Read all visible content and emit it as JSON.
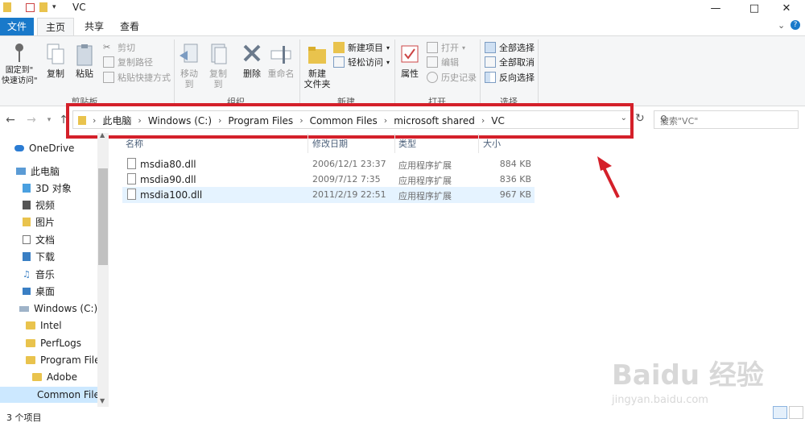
{
  "window": {
    "title": "VC"
  },
  "tabs": {
    "file": "文件",
    "home": "主页",
    "share": "共享",
    "view": "查看"
  },
  "ribbon": {
    "pin": "固定到\"\n快速访问\"",
    "copy": "复制",
    "paste": "粘贴",
    "cut": "剪切",
    "copy_path": "复制路径",
    "paste_shortcut": "粘贴快捷方式",
    "clipboard": "剪贴板",
    "move_to": "移动到",
    "copy_to": "复制到",
    "delete": "删除",
    "rename": "重命名",
    "organize": "组织",
    "new_folder_l1": "新建",
    "new_folder_l2": "文件夹",
    "new_item": "新建项目",
    "easy_access": "轻松访问",
    "new": "新建",
    "properties": "属性",
    "open": "打开",
    "edit": "编辑",
    "history": "历史记录",
    "open_group": "打开",
    "select_all": "全部选择",
    "select_none": "全部取消",
    "invert": "反向选择",
    "select": "选择"
  },
  "address": {
    "crumbs": [
      "此电脑",
      "Windows (C:)",
      "Program Files",
      "Common Files",
      "microsoft shared",
      "VC"
    ]
  },
  "search": {
    "placeholder": "搜索\"VC\""
  },
  "navpane": {
    "items": [
      "OneDrive",
      "此电脑",
      "3D 对象",
      "视频",
      "图片",
      "文档",
      "下载",
      "音乐",
      "桌面",
      "Windows (C:)",
      "Intel",
      "PerfLogs",
      "Program Files",
      "Adobe",
      "Common File"
    ]
  },
  "columns": {
    "name": "名称",
    "date": "修改日期",
    "type": "类型",
    "size": "大小"
  },
  "files": [
    {
      "name": "msdia80.dll",
      "date": "2006/12/1 23:37",
      "type": "应用程序扩展",
      "size": "884 KB"
    },
    {
      "name": "msdia90.dll",
      "date": "2009/7/12 7:35",
      "type": "应用程序扩展",
      "size": "836 KB"
    },
    {
      "name": "msdia100.dll",
      "date": "2011/2/19 22:51",
      "type": "应用程序扩展",
      "size": "967 KB"
    }
  ],
  "status": {
    "count": "3 个项目"
  },
  "watermark": {
    "line1": "Baidu 经验",
    "line2": "jingyan.baidu.com"
  },
  "colors": {
    "accent": "#1979ca",
    "highlight": "#d4202a",
    "selection": "#cce8ff"
  }
}
